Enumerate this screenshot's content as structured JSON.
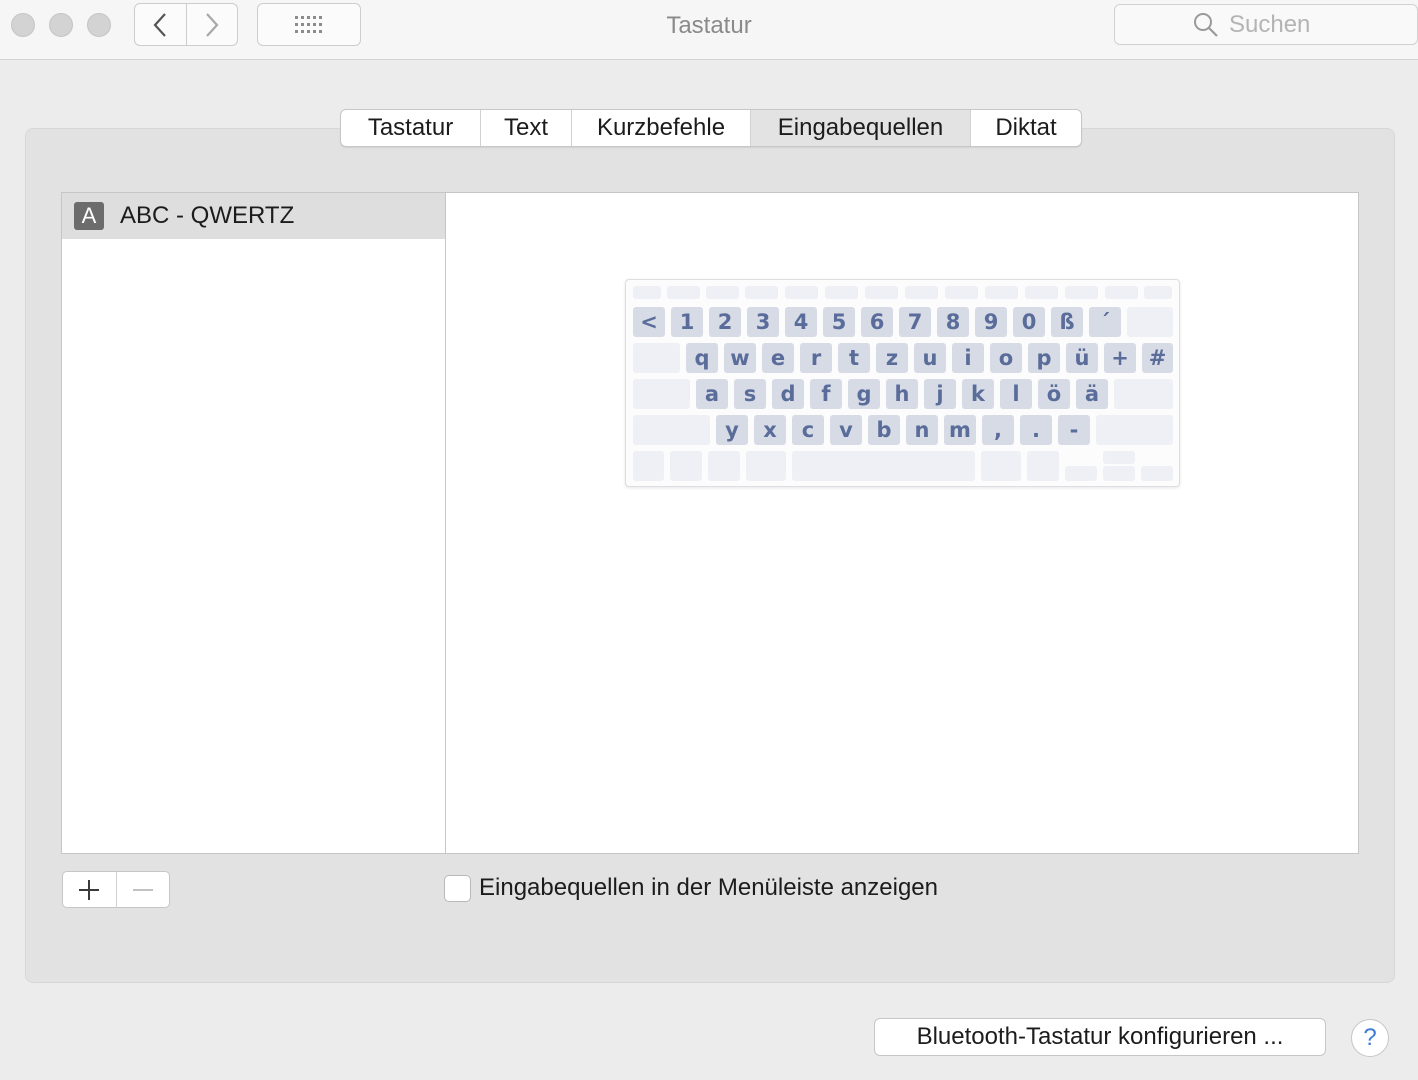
{
  "window": {
    "title": "Tastatur",
    "search_placeholder": "Suchen"
  },
  "tabs": [
    {
      "label": "Tastatur",
      "selected": false
    },
    {
      "label": "Text",
      "selected": false
    },
    {
      "label": "Kurzbefehle",
      "selected": false
    },
    {
      "label": "Eingabequellen",
      "selected": true
    },
    {
      "label": "Diktat",
      "selected": false
    }
  ],
  "sources": [
    {
      "icon_letter": "A",
      "label": "ABC - QWERTZ",
      "selected": true
    }
  ],
  "keyboard": {
    "row1": [
      "<",
      "1",
      "2",
      "3",
      "4",
      "5",
      "6",
      "7",
      "8",
      "9",
      "0",
      "ß",
      "´"
    ],
    "row2": [
      "q",
      "w",
      "e",
      "r",
      "t",
      "z",
      "u",
      "i",
      "o",
      "p",
      "ü",
      "+",
      "#"
    ],
    "row3": [
      "a",
      "s",
      "d",
      "f",
      "g",
      "h",
      "j",
      "k",
      "l",
      "ö",
      "ä"
    ],
    "row4": [
      "y",
      "x",
      "c",
      "v",
      "b",
      "n",
      "m",
      ",",
      ".",
      "-"
    ]
  },
  "controls": {
    "add_icon": "plus-icon",
    "remove_icon": "minus-icon",
    "show_in_menubar_label": "Eingabequellen in der Menüleiste anzeigen",
    "show_in_menubar_checked": false,
    "bluetooth_button_label": "Bluetooth-Tastatur konfigurieren ...",
    "help_label": "?"
  },
  "colors": {
    "key_label": "#5a6c99",
    "key_fill": "#d6dbe6",
    "help_accent": "#3e7bd8"
  }
}
